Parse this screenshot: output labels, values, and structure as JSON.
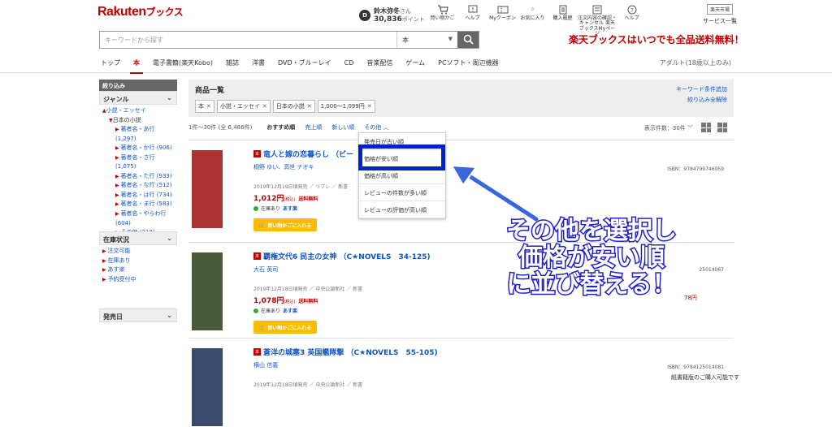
{
  "header": {
    "logo_main": "Rakuten",
    "logo_sub": "ブックス",
    "user_initial": "D",
    "user_name": "鈴木弥冬",
    "user_suffix": "さん",
    "points": "30,836",
    "points_label": "ポイント",
    "icons": [
      {
        "label": "買い物かご",
        "icon": "cart-icon"
      },
      {
        "label": "ヘルプ",
        "icon": "alert-icon"
      },
      {
        "label": "Myクーポン",
        "icon": "coupon-icon"
      },
      {
        "label": "お気に入り",
        "icon": "star-icon"
      },
      {
        "label": "購入履歴",
        "icon": "history-icon"
      },
      {
        "label": "注文内容の確認・キャンセル 楽天ブックスMyページ",
        "icon": "mypage-icon"
      },
      {
        "label": "ヘルプ",
        "icon": "help-icon"
      }
    ],
    "shop_link": "楽天市場",
    "service_list": "サービス一覧",
    "search_placeholder": "キーワードから探す",
    "search_category": "本",
    "free_shipping": "楽天ブックスはいつでも全品送料無料！"
  },
  "nav": {
    "tabs": [
      "トップ",
      "本",
      "電子書籍(楽天Kobo)",
      "雑誌",
      "洋書",
      "DVD・ブルーレイ",
      "CD",
      "音楽配信",
      "ゲーム",
      "PCソフト・周辺機器"
    ],
    "active": "本",
    "adult": "アダルト(18歳以上のみ)"
  },
  "sidebar": {
    "header": "絞り込み",
    "genre_title": "ジャンル",
    "genre_items": [
      "小説・エッセイ",
      "日本の小説",
      "著者名・あ行 (1,297)",
      "著者名・か行 (906)",
      "著者名・さ行 (1,075)",
      "著者名・た行 (933)",
      "著者名・な行 (512)",
      "著者名・は行 (734)",
      "著者名・ま行 (583)",
      "著者名・やらわ行 (604)",
      "その他 (212)"
    ],
    "stock_title": "在庫状況",
    "stock_items": [
      "注文可能",
      "在庫あり",
      "あす楽",
      "予約受付中"
    ],
    "release_title": "発売日"
  },
  "filters": {
    "title": "商品一覧",
    "keyword_link": "キーワード条件追加",
    "clear_link": "絞り込み全解除",
    "chips": [
      "本",
      "小説・エッセイ",
      "日本の小説",
      "1,000～1,099円"
    ]
  },
  "sort": {
    "count": "1件～30件 (全 6,486件)",
    "options": [
      "おすすめ順",
      "売上順",
      "新しい順",
      "その他 ︿"
    ],
    "per_page": "表示件数：30件 ﹀",
    "dropdown": [
      "発売日が古い順",
      "価格が安い順",
      "価格が高い順",
      "レビューの件数が多い順",
      "レビューの評価が高い順"
    ]
  },
  "items": [
    {
      "tag": "本",
      "title": "竜人と嫁の恋暮らし （ビー",
      "author": "桐野 ゆい、高世 ナオキ",
      "date": "2019年12月19日頃発売 ／ リブレ ／ 新書",
      "price": "1,012円",
      "tax": "(税込)",
      "ship": "送料無料",
      "stock": "在庫あり",
      "asu": "あす楽",
      "cart": "買い物かごに入れる",
      "isbn": "ISBN：9784799746059",
      "cover_color": "#a33"
    },
    {
      "tag": "本",
      "title": "覇権文代6 民主の女神 （C★NOVELS　34-125)",
      "author": "大石 英司",
      "date": "2019年12月18日頃発売 ／ 中央公論新社 ／ 新書",
      "price": "1,078円",
      "tax": "(税込)",
      "ship": "送料無料",
      "stock": "在庫あり",
      "asu": "あす楽",
      "cart": "買い物かごに入れる",
      "isbn": "25014067",
      "cover_color": "#4a5a3a"
    },
    {
      "tag": "本",
      "title": "蒼洋の城塞3 英国艦隊撃 （C★NOVELS　55-105)",
      "author": "横山 信義",
      "date": "2019年12月18日頃発売 ／ 中央公論新社 ／ 新書",
      "price": "",
      "tax": "",
      "ship": "",
      "stock": "",
      "asu": "",
      "cart": "",
      "isbn": "ISBN：9784125014081",
      "cover_color": "#3a4a6a"
    }
  ],
  "item2_price_tail": "78円",
  "item3_note": "紙書籍版のご購入可能です",
  "annotation": [
    "その他を選択し",
    "価格が安い順",
    "に並び替える！"
  ],
  "colors": {
    "brand": "#bf0000",
    "link": "#1155cc",
    "highlight": "#0022cc"
  }
}
